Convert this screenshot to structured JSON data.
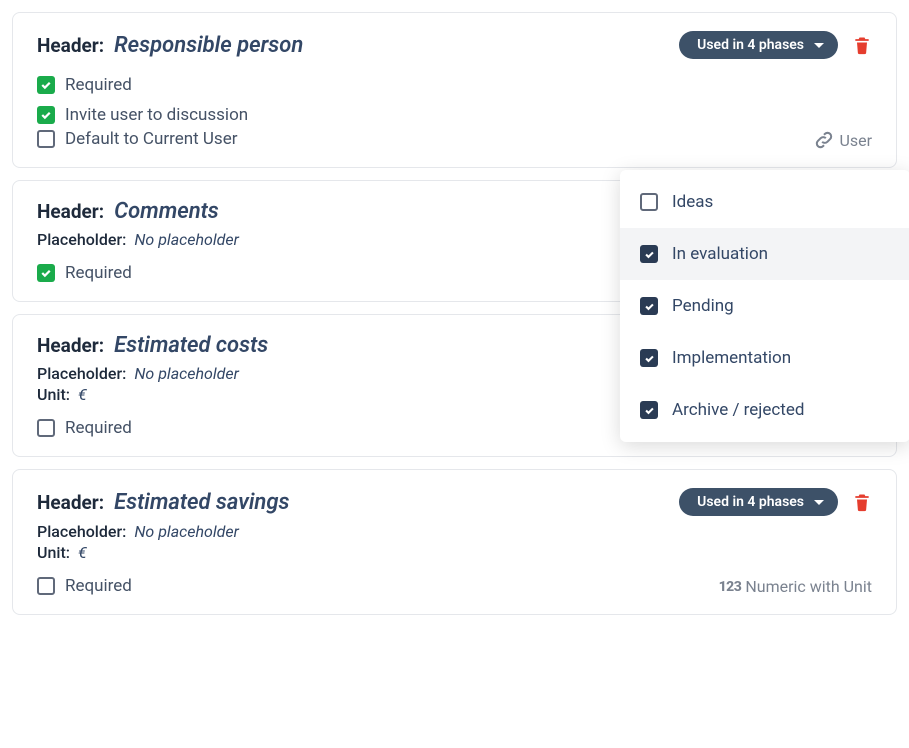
{
  "labels": {
    "header": "Header:",
    "placeholder": "Placeholder:",
    "unit": "Unit:",
    "no_placeholder": "No placeholder"
  },
  "phases_pill": "Used in 4 phases",
  "types": {
    "user": "User",
    "numeric": "Numeric with Unit",
    "numeric_prefix": "123"
  },
  "cards": [
    {
      "header": "Responsible person",
      "checks": [
        {
          "label": "Required",
          "checked": true
        },
        {
          "label": "Invite user to discussion",
          "checked": true
        },
        {
          "label": "Default to Current User",
          "checked": false
        }
      ],
      "unit": null,
      "placeholder": null,
      "type": "user",
      "show_pill": true
    },
    {
      "header": "Comments",
      "placeholder": "No placeholder",
      "checks": [
        {
          "label": "Required",
          "checked": true
        }
      ],
      "unit": null,
      "type": null,
      "show_pill": false
    },
    {
      "header": "Estimated costs",
      "placeholder": "No placeholder",
      "unit": "€",
      "checks": [
        {
          "label": "Required",
          "checked": false
        }
      ],
      "type": "numeric",
      "show_pill": false
    },
    {
      "header": "Estimated savings",
      "placeholder": "No placeholder",
      "unit": "€",
      "checks": [
        {
          "label": "Required",
          "checked": false
        }
      ],
      "type": "numeric",
      "show_pill": true
    }
  ],
  "dropdown": {
    "items": [
      {
        "label": "Ideas",
        "checked": false,
        "highlight": false
      },
      {
        "label": "In evaluation",
        "checked": true,
        "highlight": true
      },
      {
        "label": "Pending",
        "checked": true,
        "highlight": false
      },
      {
        "label": "Implementation",
        "checked": true,
        "highlight": false
      },
      {
        "label": "Archive / rejected",
        "checked": true,
        "highlight": false
      }
    ]
  }
}
